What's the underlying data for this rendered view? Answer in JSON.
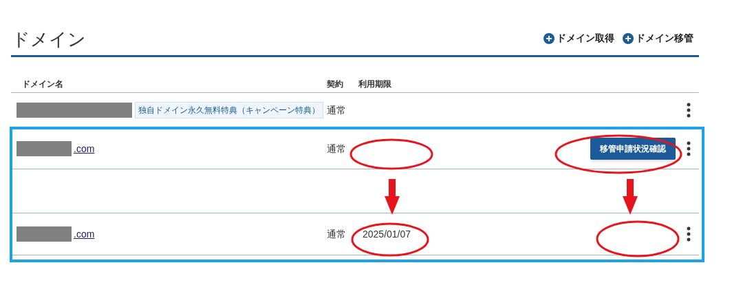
{
  "title": "ドメイン",
  "actions": [
    {
      "label": "ドメイン取得"
    },
    {
      "label": "ドメイン移管"
    }
  ],
  "columns": {
    "name": "ドメイン名",
    "contract": "契約",
    "expiry": "利用期限"
  },
  "rows": [
    {
      "kind": "domain",
      "redacted": true,
      "badge": "独自ドメイン永久無料特典（キャンペーン特典）",
      "contract": "通常"
    },
    {
      "kind": "domain",
      "redacted": true,
      "suffix": ".com",
      "contract": "通常",
      "button": "移管申請状況確認"
    },
    {
      "kind": "blank"
    },
    {
      "kind": "domain",
      "redacted": true,
      "suffix": ".com",
      "contract": "通常",
      "expiry": "2025/01/07"
    }
  ]
}
